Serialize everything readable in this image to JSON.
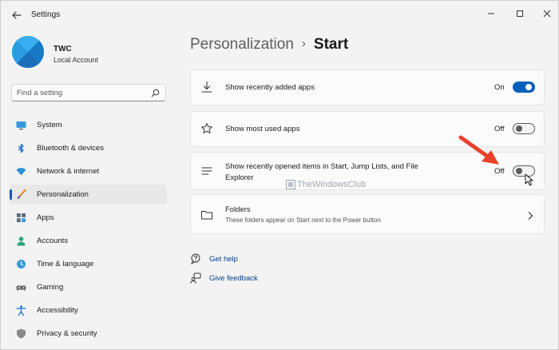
{
  "window": {
    "title": "Settings"
  },
  "user": {
    "name": "TWC",
    "account_type": "Local Account"
  },
  "search": {
    "placeholder": "Find a setting"
  },
  "sidebar": {
    "items": [
      {
        "label": "System",
        "icon": "monitor-icon",
        "active": false
      },
      {
        "label": "Bluetooth & devices",
        "icon": "bluetooth-icon",
        "active": false
      },
      {
        "label": "Network & internet",
        "icon": "wifi-icon",
        "active": false
      },
      {
        "label": "Personalization",
        "icon": "brush-icon",
        "active": true
      },
      {
        "label": "Apps",
        "icon": "apps-grid-icon",
        "active": false
      },
      {
        "label": "Accounts",
        "icon": "person-icon",
        "active": false
      },
      {
        "label": "Time & language",
        "icon": "clock-globe-icon",
        "active": false
      },
      {
        "label": "Gaming",
        "icon": "gamepad-icon",
        "active": false
      },
      {
        "label": "Accessibility",
        "icon": "accessibility-icon",
        "active": false
      },
      {
        "label": "Privacy & security",
        "icon": "shield-icon",
        "active": false
      }
    ]
  },
  "breadcrumb": {
    "parent": "Personalization",
    "separator": "›",
    "current": "Start"
  },
  "settings": {
    "recently_added": {
      "label": "Show recently added apps",
      "state": "On",
      "on": true
    },
    "most_used": {
      "label": "Show most used apps",
      "state": "Off",
      "on": false
    },
    "recently_opened": {
      "label_line1": "Show recently opened items in Start, Jump Lists, and File",
      "label_line2": "Explorer",
      "state": "Off",
      "on": false
    },
    "folders": {
      "label": "Folders",
      "description": "These folders appear on Start next to the Power button"
    }
  },
  "watermark": {
    "text": "TheWindowsClub"
  },
  "links": {
    "help": "Get help",
    "feedback": "Give feedback"
  },
  "colors": {
    "accent": "#005fb8",
    "annotation_arrow": "#e8412c",
    "background": "#f3f3f3",
    "card": "#fbfbfb"
  }
}
